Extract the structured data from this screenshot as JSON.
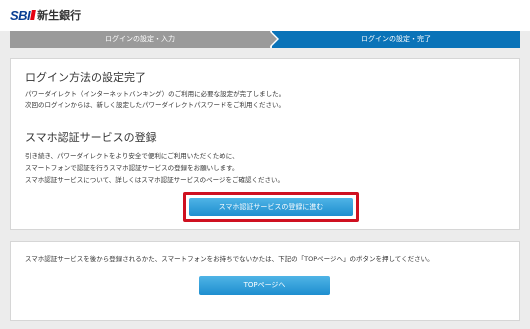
{
  "brand": {
    "sbi": "SBI",
    "name": "新生銀行"
  },
  "steps": [
    {
      "label": "ログインの設定・入力",
      "state": "done"
    },
    {
      "label": "ログインの設定・完了",
      "state": "current"
    }
  ],
  "complete": {
    "title": "ログイン方法の設定完了",
    "line1": "パワーダイレクト（インターネットバンキング）のご利用に必要な設定が完了しました。",
    "line2": "次回のログインからは、新しく設定したパワーダイレクトパスワードをご利用ください。"
  },
  "smartphone": {
    "title": "スマホ認証サービスの登録",
    "line1": "引き続き、パワーダイレクトをより安全で便利にご利用いただくために、",
    "line2": "スマートフォンで認証を行うスマホ認証サービスの登録をお願いします。",
    "line3": "スマホ認証サービスについて、詳しくはスマホ認証サービスのページをご確認ください。",
    "button": "スマホ認証サービスの登録に進む"
  },
  "later": {
    "text": "スマホ認証サービスを後から登録されるかた、スマートフォンをお持ちでないかたは、下記の「TOPページへ」のボタンを押してください。",
    "button": "TOPページへ"
  },
  "colors": {
    "accent": "#0a73b8",
    "button": "#2596d8",
    "highlight": "#cf1020",
    "step_done": "#9a9a9a"
  }
}
